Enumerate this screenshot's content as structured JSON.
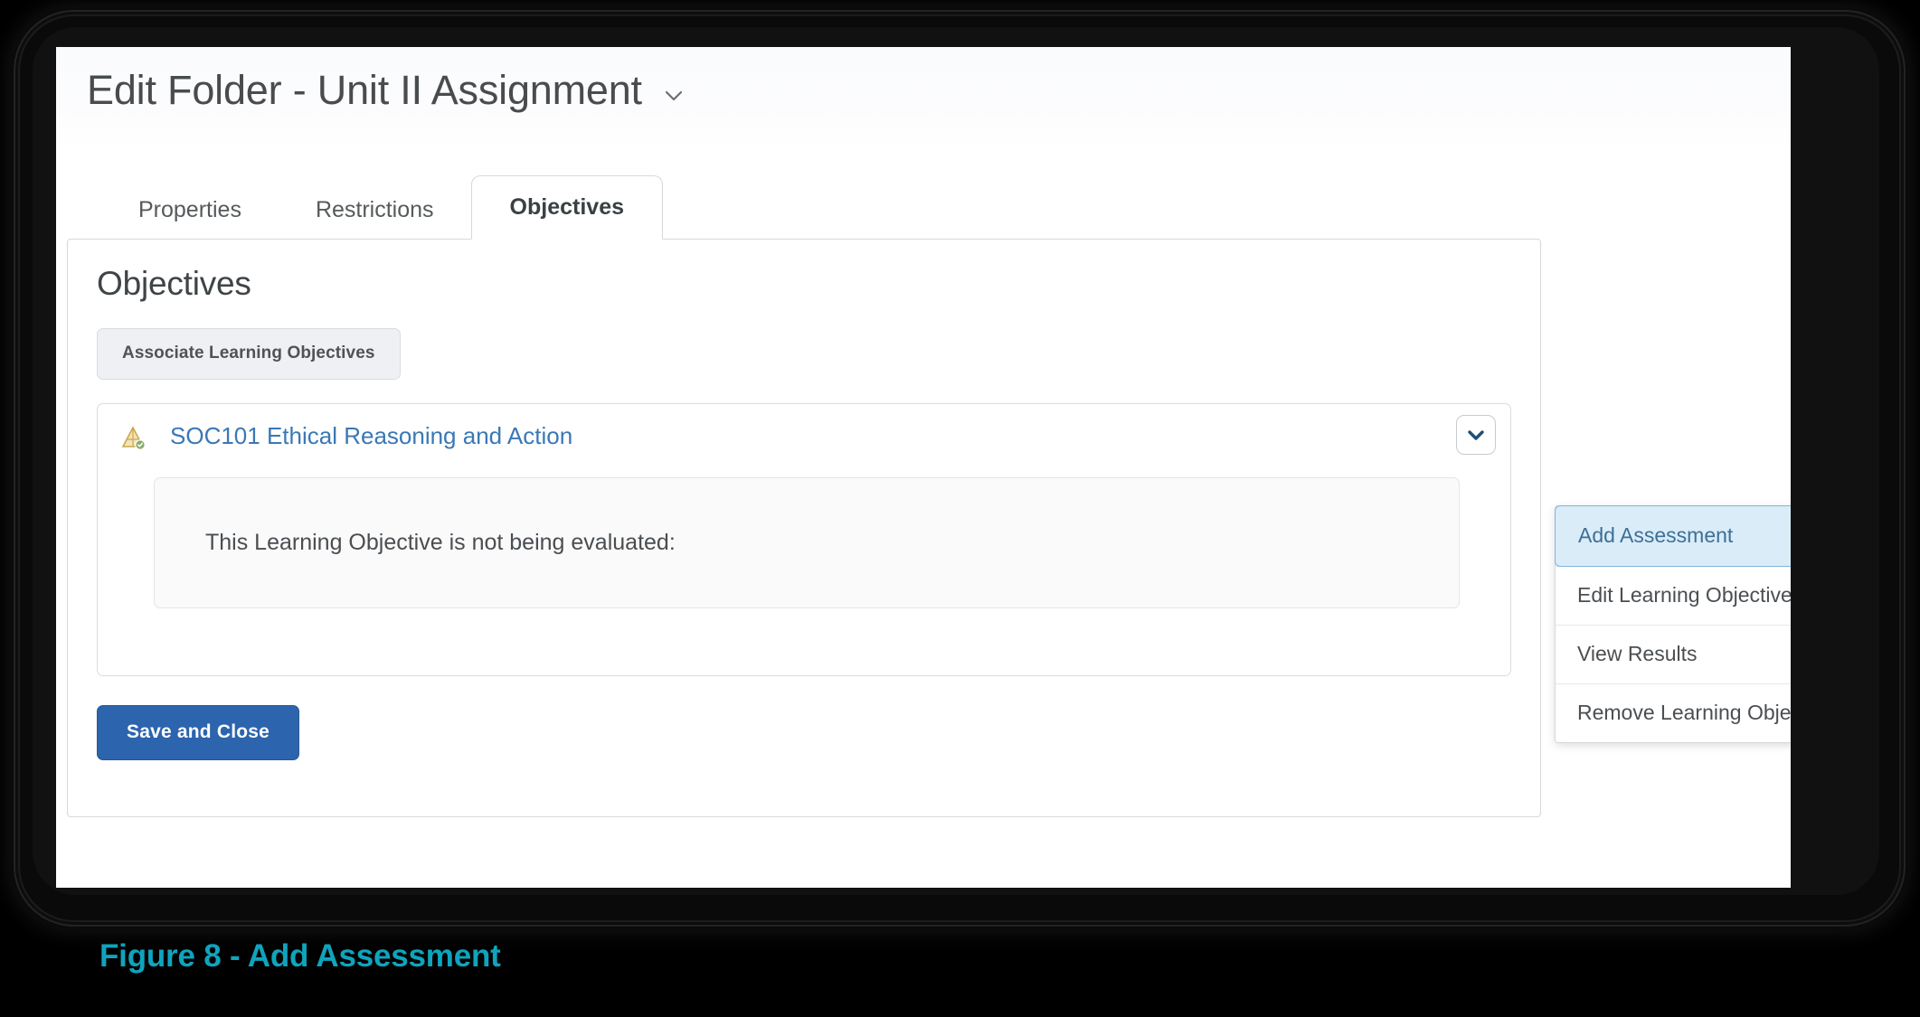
{
  "window": {
    "title": "Edit Folder - Unit II Assignment",
    "title_chevron_icon": "chevron-down-icon"
  },
  "tabs": [
    {
      "label": "Properties",
      "active": false
    },
    {
      "label": "Restrictions",
      "active": false
    },
    {
      "label": "Objectives",
      "active": true
    }
  ],
  "panel": {
    "heading": "Objectives",
    "associate_button": "Associate Learning Objectives",
    "objective": {
      "icon": "pyramid-objective-icon",
      "link_text": "SOC101 Ethical Reasoning and Action",
      "chevron_icon": "chevron-down-icon",
      "evaluation_text": "This Learning Objective is not being evaluated:"
    },
    "save_button": "Save and Close"
  },
  "dropdown": {
    "items": [
      {
        "label": "Add Assessment",
        "highlighted": true
      },
      {
        "label": "Edit Learning Objective",
        "highlighted": false
      },
      {
        "label": "View Results",
        "highlighted": false
      },
      {
        "label": "Remove Learning Objective",
        "highlighted": false
      }
    ]
  },
  "caption": {
    "text": "Figure 8 - Add Assessment"
  },
  "colors": {
    "accent_blue": "#2c64ae",
    "link_blue": "#3a78b5",
    "highlight_bg": "#d9ecf8",
    "caption_teal": "#0fa4bd"
  }
}
